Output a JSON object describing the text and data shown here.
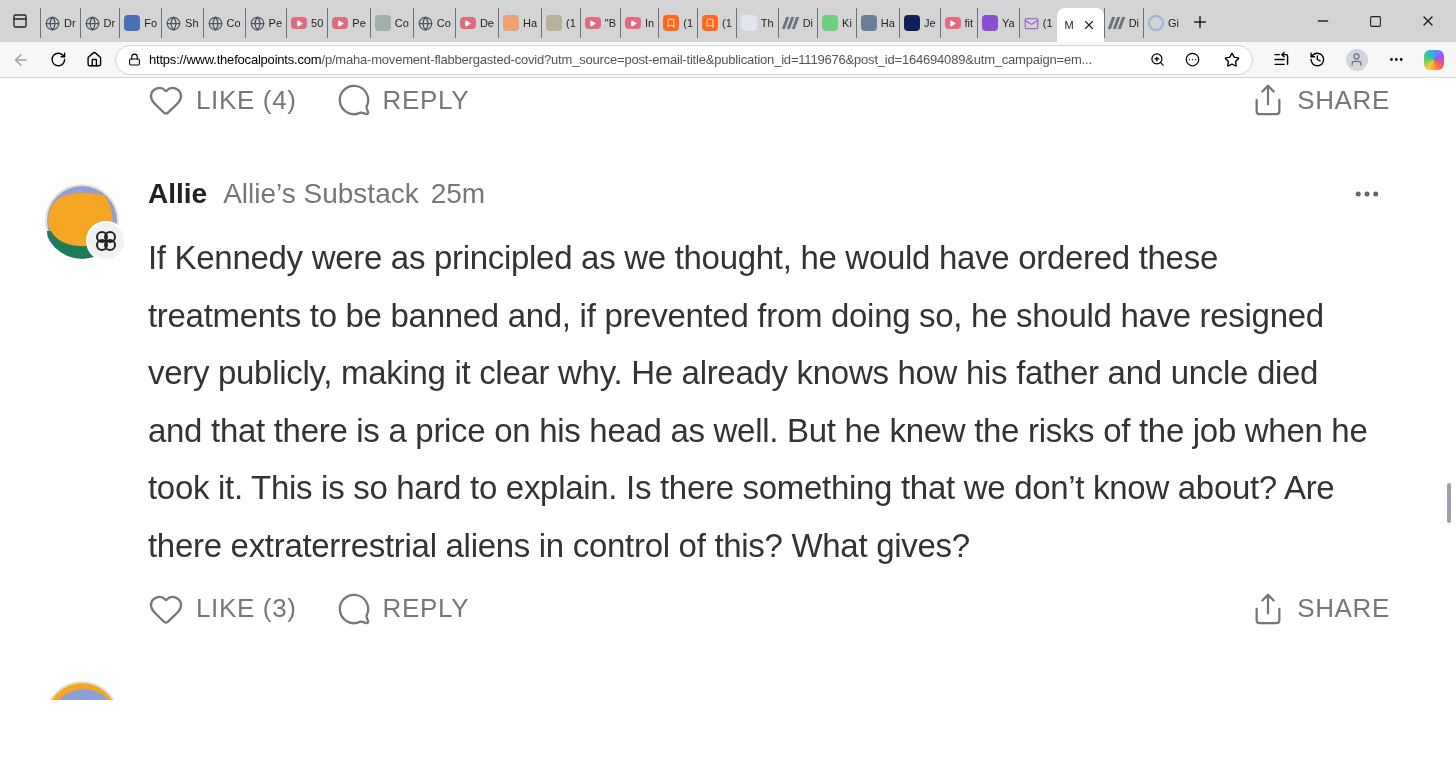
{
  "browser": {
    "tabs": [
      {
        "label": "Dr",
        "kind": "globe",
        "selected": false
      },
      {
        "label": "Dr",
        "kind": "globe",
        "selected": false
      },
      {
        "label": "Fo",
        "kind": "tile",
        "color": "#4a6fb5",
        "selected": false
      },
      {
        "label": "Sh",
        "kind": "globe",
        "selected": false
      },
      {
        "label": "Co",
        "kind": "globe",
        "selected": false
      },
      {
        "label": "Pe",
        "kind": "globe",
        "selected": false
      },
      {
        "label": "50",
        "kind": "video",
        "selected": false
      },
      {
        "label": "Pe",
        "kind": "video",
        "selected": false
      },
      {
        "label": "Co",
        "kind": "tile",
        "color": "#9fb0a8",
        "selected": false
      },
      {
        "label": "Co",
        "kind": "globe",
        "selected": false
      },
      {
        "label": "De",
        "kind": "video",
        "selected": false
      },
      {
        "label": "Ha",
        "kind": "tile",
        "color": "#f0a070",
        "selected": false
      },
      {
        "label": "(1",
        "kind": "tile",
        "color": "#b8b09a",
        "selected": false
      },
      {
        "label": "\"B",
        "kind": "video",
        "selected": false
      },
      {
        "label": "In",
        "kind": "video",
        "selected": false
      },
      {
        "label": "(1",
        "kind": "bookmark",
        "selected": false
      },
      {
        "label": "(1",
        "kind": "bookmark",
        "selected": false
      },
      {
        "label": "Th",
        "kind": "tile",
        "color": "#dfe6f0",
        "selected": false
      },
      {
        "label": "Di",
        "kind": "stripes",
        "selected": false
      },
      {
        "label": "Ki",
        "kind": "tile",
        "color": "#6fcf7f",
        "selected": false
      },
      {
        "label": "Ha",
        "kind": "tile",
        "color": "#6a7f9a",
        "selected": false
      },
      {
        "label": "Je",
        "kind": "tile",
        "color": "#10205a",
        "selected": false
      },
      {
        "label": "fit",
        "kind": "video",
        "selected": false
      },
      {
        "label": "Ya",
        "kind": "tile",
        "color": "#8a4fd0",
        "selected": false
      },
      {
        "label": "(1",
        "kind": "mail",
        "selected": false
      },
      {
        "label": "M",
        "kind": "none",
        "selected": true
      },
      {
        "label": "Di",
        "kind": "stripes",
        "selected": false
      },
      {
        "label": "Gi",
        "kind": "google",
        "selected": false
      }
    ],
    "url_host": "https://www.thefocalpoints.com",
    "url_path": "/p/maha-movement-flabbergasted-covid?utm_source=post-email-title&publication_id=1119676&post_id=164694089&utm_campaign=em..."
  },
  "top_actions": {
    "like": "LIKE (4)",
    "reply": "REPLY",
    "share": "SHARE"
  },
  "comment": {
    "author": "Allie",
    "publication": "Allie’s Substack",
    "time": "25m",
    "body": "If Kennedy were as principled as we thought, he would have ordered these treatments to be banned and, if prevented from doing so, he should have resigned very publicly, making it clear why. He already knows how his father and uncle died and that there is a price on his head as well. But he knew the risks of the job when he took it. This is so hard to explain. Is there something that we don’t know about? Are there extraterrestrial aliens in control of this? What gives?",
    "like": "LIKE (3)",
    "reply": "REPLY",
    "share": "SHARE"
  }
}
